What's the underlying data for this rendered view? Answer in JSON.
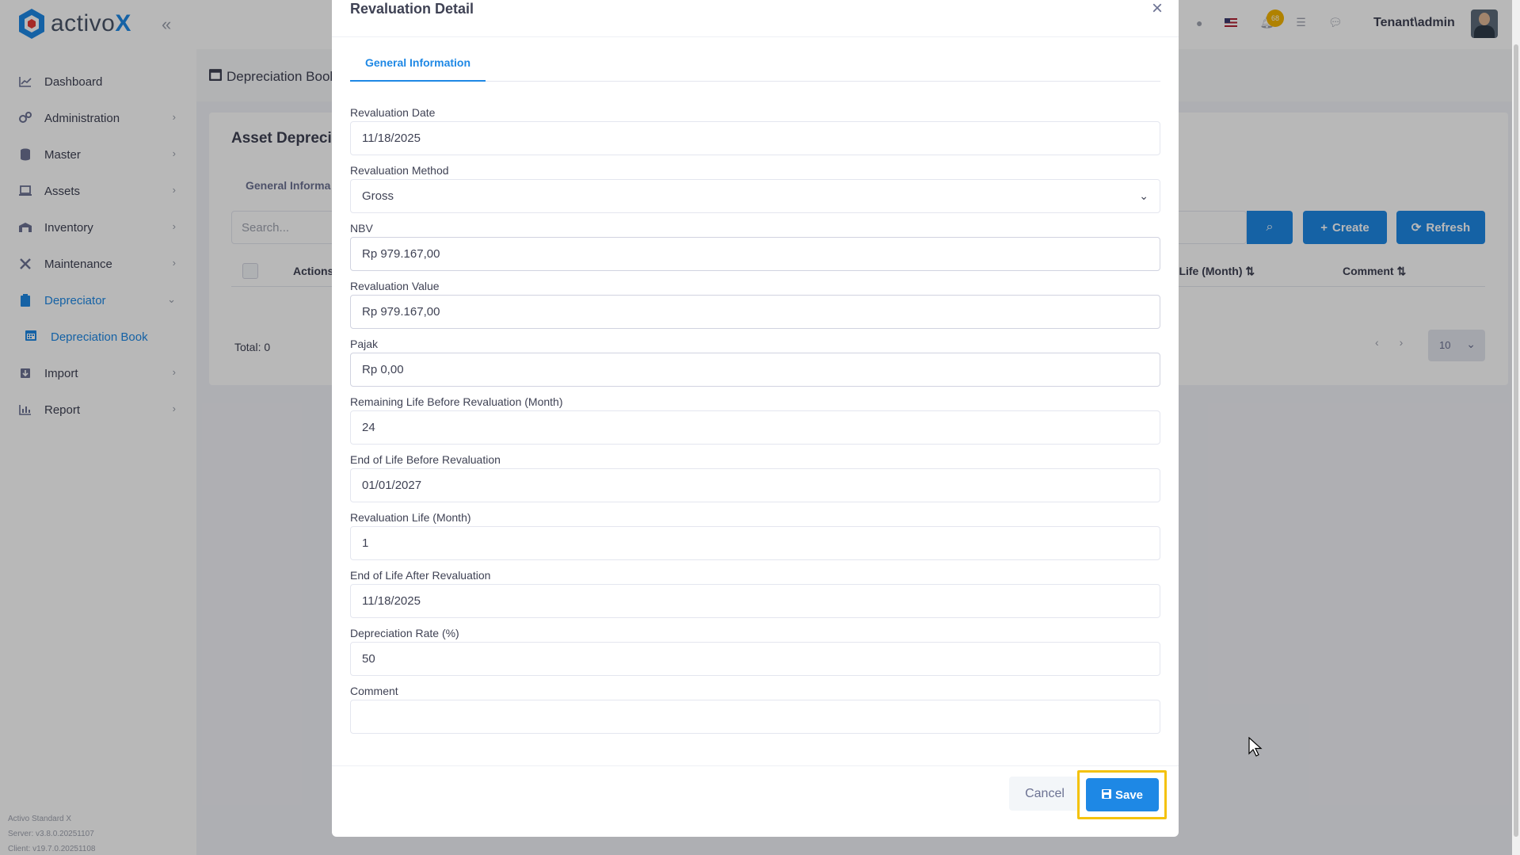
{
  "app": {
    "logo_text": "activo",
    "logo_x": "X",
    "collapse_icon": "double-chevron-left-icon"
  },
  "sidebar": {
    "items": [
      {
        "label": "Dashboard",
        "icon": "chart-line-icon"
      },
      {
        "label": "Administration",
        "icon": "cogs-icon"
      },
      {
        "label": "Master",
        "icon": "database-icon"
      },
      {
        "label": "Assets",
        "icon": "laptop-icon"
      },
      {
        "label": "Inventory",
        "icon": "warehouse-icon"
      },
      {
        "label": "Maintenance",
        "icon": "tools-icon"
      },
      {
        "label": "Depreciator",
        "icon": "clipboard-icon"
      },
      {
        "label": "Import",
        "icon": "import-icon"
      },
      {
        "label": "Report",
        "icon": "chart-bar-icon"
      }
    ],
    "sub_item": {
      "label": "Depreciation Book",
      "icon": "calendar-icon"
    },
    "footer": {
      "line1": "Activo Standard X",
      "line2": "Server: v3.8.0.20251107",
      "line3": "Client: v19.7.0.20251108"
    }
  },
  "header": {
    "notification_count": "68",
    "tenant": "Tenant\\admin"
  },
  "page": {
    "title": "Depreciation Book",
    "card_title": "Asset Deprecia",
    "tab": "General Informa",
    "search_placeholder": "Search...",
    "create_label": "Create",
    "refresh_label": "Refresh",
    "columns": [
      "Actions",
      "n Life (Month)",
      "Comment"
    ],
    "total": "Total: 0",
    "page_size": "10"
  },
  "modal": {
    "title": "Revaluation Detail",
    "tab": "General Information",
    "fields": [
      {
        "label": "Revaluation Date",
        "value": "11/18/2025"
      },
      {
        "label": "Revaluation Method",
        "value": "Gross"
      },
      {
        "label": "NBV",
        "value": "Rp 979.167,00"
      },
      {
        "label": "Revaluation Value",
        "value": "Rp 979.167,00"
      },
      {
        "label": "Pajak",
        "value": "Rp 0,00"
      },
      {
        "label": "Remaining Life Before Revaluation (Month)",
        "value": "24"
      },
      {
        "label": "End of Life Before Revaluation",
        "value": "01/01/2027"
      },
      {
        "label": "Revaluation Life (Month)",
        "value": "1"
      },
      {
        "label": "End of Life After Revaluation",
        "value": "11/18/2025"
      },
      {
        "label": "Depreciation Rate (%)",
        "value": "50"
      },
      {
        "label": "Comment",
        "value": ""
      }
    ],
    "cancel_label": "Cancel",
    "save_label": "Save"
  },
  "colors": {
    "accent": "#1e88e5",
    "highlight": "#f4c20d",
    "badge": "#f4b400"
  }
}
